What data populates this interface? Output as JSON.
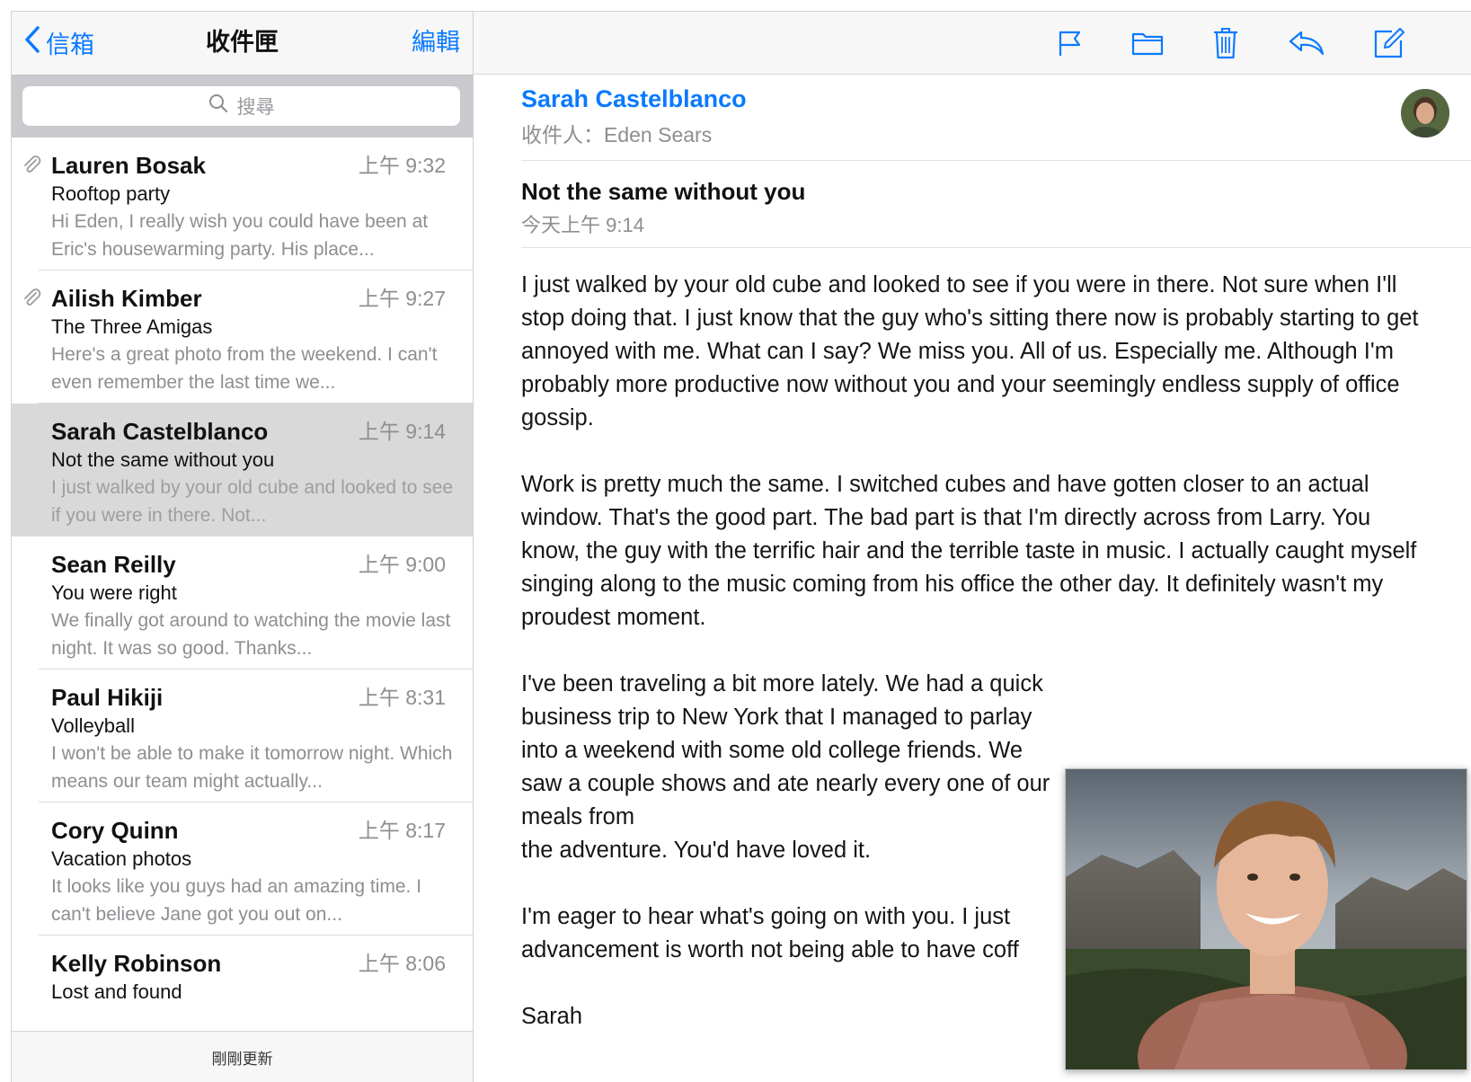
{
  "list_nav": {
    "back_label": "信箱",
    "title": "收件匣",
    "edit_label": "編輯"
  },
  "search": {
    "placeholder": "搜尋"
  },
  "messages": [
    {
      "sender": "Lauren Bosak",
      "time": "上午 9:32",
      "subject": "Rooftop party",
      "preview": "Hi Eden, I really wish you could have been at Eric's housewarming party. His place...",
      "attachment": true,
      "selected": false
    },
    {
      "sender": "Ailish Kimber",
      "time": "上午 9:27",
      "subject": "The Three Amigas",
      "preview": "Here's a great photo from the weekend. I can't even remember the last time we...",
      "attachment": true,
      "selected": false
    },
    {
      "sender": "Sarah Castelblanco",
      "time": "上午 9:14",
      "subject": "Not the same without you",
      "preview": "I just walked by your old cube and looked to see if you were in there. Not...",
      "attachment": false,
      "selected": true
    },
    {
      "sender": "Sean Reilly",
      "time": "上午 9:00",
      "subject": "You were right",
      "preview": "We finally got around to watching the movie last night. It was so good. Thanks...",
      "attachment": false,
      "selected": false
    },
    {
      "sender": "Paul Hikiji",
      "time": "上午 8:31",
      "subject": "Volleyball",
      "preview": "I won't be able to make it tomorrow night. Which means our team might actually...",
      "attachment": false,
      "selected": false
    },
    {
      "sender": "Cory Quinn",
      "time": "上午 8:17",
      "subject": "Vacation photos",
      "preview": "It looks like you guys had an amazing time. I can't believe Jane got you out on...",
      "attachment": false,
      "selected": false
    },
    {
      "sender": "Kelly Robinson",
      "time": "上午 8:06",
      "subject": "Lost and found",
      "preview": "",
      "attachment": false,
      "selected": false
    }
  ],
  "list_footer": {
    "status": "剛剛更新"
  },
  "toolbar": {
    "icons": [
      "flag-icon",
      "folder-icon",
      "trash-icon",
      "reply-icon",
      "compose-icon"
    ]
  },
  "email": {
    "from": "Sarah Castelblanco",
    "to_line": "收件人：Eden Sears",
    "subject": "Not the same without you",
    "date": "今天上午 9:14",
    "paragraphs": [
      "I just walked by your old cube and looked to see if you were in there. Not sure when I'll stop doing that. I just know that the guy who's sitting there now is probably starting to get annoyed with me. What can I say? We miss you. All of us. Especially me. Although I'm probably more productive now without you and your seemingly endless supply of office gossip.",
      "Work is pretty much the same. I switched cubes and have gotten closer to an actual window. That's the good part. The bad part is that I'm directly across from Larry. You know, the guy with the terrific hair and the terrible taste in music. I actually caught myself singing along to the music coming from his office the other day. It definitely wasn't my proudest moment.",
      "I've been traveling a bit more lately. We had a quick business trip to New York that I managed to parlay into a weekend with some old college friends. We saw a couple shows and ate nearly every one of our meals from",
      "I'm eager to hear what's going on with you. I just",
      "Sarah"
    ],
    "paragraph_tails": [
      "",
      "",
      "the adventure. You'd have loved it.",
      "advancement is worth not being able to have coff",
      ""
    ]
  },
  "colors": {
    "accent": "#0a7aff",
    "selected_row": "#d9d9d9",
    "secondary_text": "#8e8e93"
  }
}
